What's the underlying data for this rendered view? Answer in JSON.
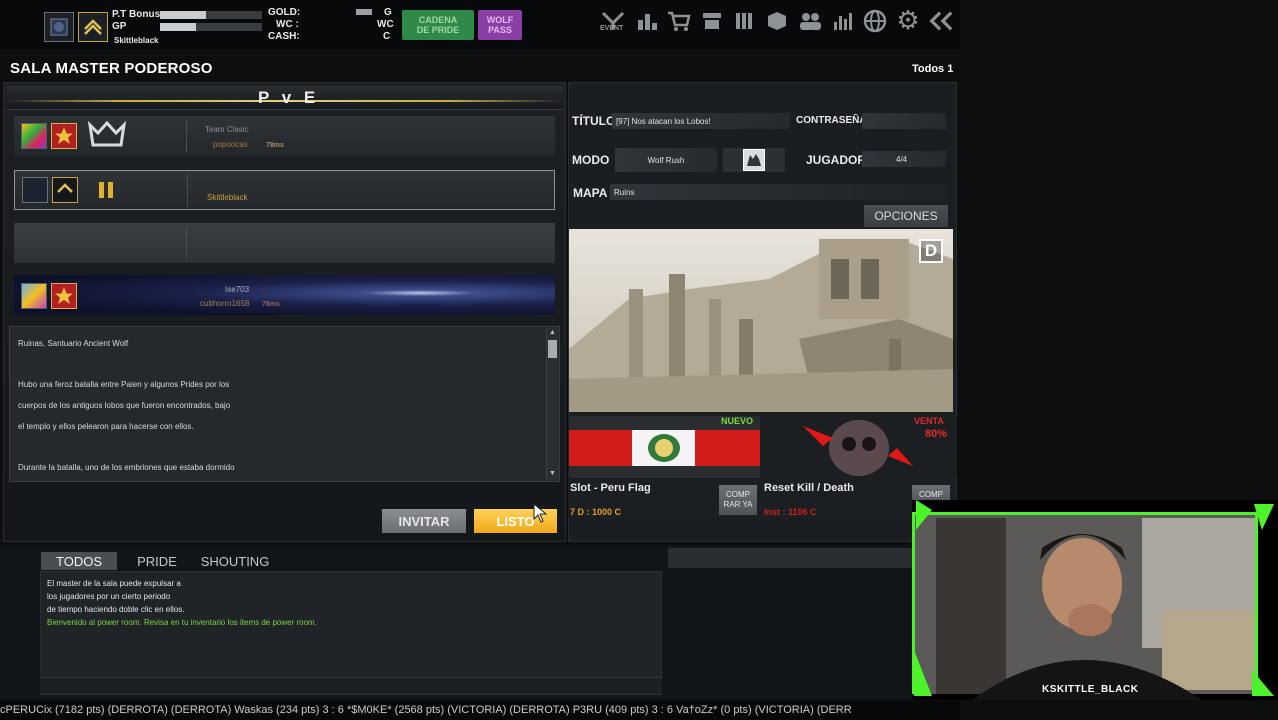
{
  "hud": {
    "player_name": "P.T Bonus",
    "gp_label": "GP",
    "username": "Skittleblack",
    "gold_label": "GOLD:",
    "wc_label": "WC :",
    "cash_label": "CASH:",
    "gold_value": "G",
    "wc_value": "WC",
    "cash_value": "C",
    "cadena_label": "CADENA\nDE PRIDE",
    "wolf_label": "WOLF\nPASS",
    "event_label": "EVENT",
    "bonus_progress": 0.45,
    "gp_progress": 0.35
  },
  "room": {
    "title": "SALA MASTER PODEROSO",
    "count": "Todos 1",
    "mode_banner": "P v E"
  },
  "slots": [
    {
      "team": "Team Clasic",
      "name": "popoocas",
      "ping": "78ms"
    },
    {
      "name": "Skittleblack"
    },
    {},
    {
      "name": "Ise703",
      "sub": "cubhorro1658",
      "ping": "78ms"
    }
  ],
  "description": {
    "lines": [
      "Ruinas, Santuario Ancient Wolf",
      "",
      "Hubo una feroz batalla entre Paien y algunos Prides por los",
      "cuerpos de los antiguos lobos que fueron encontrados, bajo",
      "el templo y ellos pelearon para hacerse con ellos.",
      "",
      "Durante la batalla, uno de los embriones que estaba dormido"
    ]
  },
  "buttons": {
    "invite": "INVITAR",
    "ready": "LISTO"
  },
  "room_info": {
    "title_label": "TÍTULO",
    "title_value": "[97] Nos atacan los Lobos!",
    "password_label": "CONTRASEÑA",
    "password_value": "",
    "mode_label": "MODO",
    "mode_value": "Wolf Rush",
    "player_label": "JUGADOR",
    "player_value": "4/4",
    "map_label": "MAPA",
    "map_value": "Ruins",
    "options": "OPCIONES",
    "difficulty": "D"
  },
  "shop": [
    {
      "name": "Slot - Peru Flag",
      "tag": "NUEVO",
      "price": "7 D : 1000 C",
      "button": "COMP\nRAR YA",
      "price_color": "#e0a020"
    },
    {
      "name": "Reset Kill / Death",
      "tag": "VENTA",
      "discount": "80%",
      "price": "Inst : 1106 C",
      "button": "COMP",
      "price_color": "#d02020"
    }
  ],
  "chat": {
    "tabs": [
      "TODOS",
      "PRIDE",
      "SHOUTING"
    ],
    "lines": [
      {
        "text": "El master de la sala puede expulsar a",
        "color": "#e4e6e8"
      },
      {
        "text": "los jugadores por un cierto periodo",
        "color": "#e4e6e8"
      },
      {
        "text": "de tiempo haciendo doble clic en ellos.",
        "color": "#e4e6e8"
      },
      {
        "text": "Bienvenido al power room. Revisa en tu inventario los items de power room.",
        "color": "#7ed04a"
      }
    ]
  },
  "ticker": {
    "text": "cPERUCix (7182 pts) (DERROTA)     (DERROTA) Waskas (234 pts) 3 : 6 *$M0KE* (2568 pts) (VICTORIA)     (DERROTA) P3RU (409 pts) 3 : 6 Va†oZz* (0 pts) (VICTORIA)     (DERR"
  },
  "webcam": {
    "overlay_name": "KSKITTLE_BLACK"
  },
  "colors": {
    "cadena_green": "#2f8a4a",
    "wolf_purple": "#8a3fa6",
    "ready_yellow": "#f0b020",
    "accent_gold": "#c7a84a",
    "webcam_green": "#4df32a"
  }
}
